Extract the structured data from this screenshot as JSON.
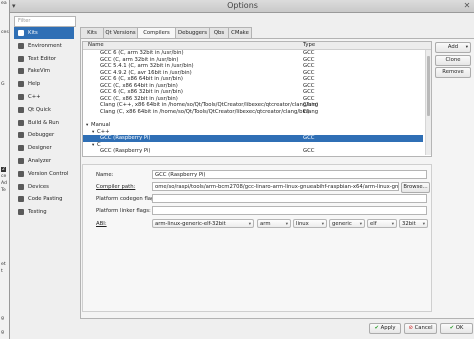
{
  "window": {
    "title": "Options"
  },
  "background_fragments": [
    {
      "text": "ea"
    },
    {
      "text": "ces"
    },
    {
      "text": "G"
    },
    {
      "text": "2"
    },
    {
      "text": "ce"
    },
    {
      "text": "Ad"
    },
    {
      "text": "Te"
    },
    {
      "text": "et"
    },
    {
      "text": "t"
    },
    {
      "text": "g"
    },
    {
      "text": "g"
    }
  ],
  "sidebar": {
    "filter_placeholder": "Filter",
    "items": [
      {
        "label": "Kits",
        "icon": "kits-icon",
        "color": "#3c7dd0",
        "selected": true
      },
      {
        "label": "Environment",
        "icon": "environment-icon",
        "color": "#5a5a5a"
      },
      {
        "label": "Text Editor",
        "icon": "text-editor-icon",
        "color": "#5a5a5a"
      },
      {
        "label": "FakeVim",
        "icon": "fakevim-icon",
        "color": "#5a5a5a"
      },
      {
        "label": "Help",
        "icon": "help-icon",
        "color": "#5a5a5a"
      },
      {
        "label": "C++",
        "icon": "cpp-icon",
        "color": "#5a5a5a"
      },
      {
        "label": "Qt Quick",
        "icon": "qt-quick-icon",
        "color": "#5a5a5a"
      },
      {
        "label": "Build & Run",
        "icon": "build-run-icon",
        "color": "#5a5a5a"
      },
      {
        "label": "Debugger",
        "icon": "debugger-icon",
        "color": "#5a5a5a"
      },
      {
        "label": "Designer",
        "icon": "designer-icon",
        "color": "#5a5a5a"
      },
      {
        "label": "Analyzer",
        "icon": "analyzer-icon",
        "color": "#5a5a5a"
      },
      {
        "label": "Version Control",
        "icon": "version-control-icon",
        "color": "#5a5a5a"
      },
      {
        "label": "Devices",
        "icon": "devices-icon",
        "color": "#5a5a5a"
      },
      {
        "label": "Code Pasting",
        "icon": "code-pasting-icon",
        "color": "#5a5a5a"
      },
      {
        "label": "Testing",
        "icon": "testing-icon",
        "color": "#5a5a5a"
      }
    ]
  },
  "tabs": [
    {
      "label": "Kits"
    },
    {
      "label": "Qt Versions"
    },
    {
      "label": "Compilers",
      "active": true
    },
    {
      "label": "Debuggers"
    },
    {
      "label": "Qbs"
    },
    {
      "label": "CMake"
    }
  ],
  "tree": {
    "columns": [
      "Name",
      "Type"
    ],
    "rows": [
      {
        "name": "GCC 6 (C, arm 32bit in /usr/bin)",
        "type": "GCC",
        "indent": 3
      },
      {
        "name": "GCC (C, arm 32bit in /usr/bin)",
        "type": "GCC",
        "indent": 3
      },
      {
        "name": "GCC 5.4.1 (C, arm 32bit in /usr/bin)",
        "type": "GCC",
        "indent": 3
      },
      {
        "name": "GCC 4.9.2 (C, avr 16bit in /usr/bin)",
        "type": "GCC",
        "indent": 3
      },
      {
        "name": "GCC 6 (C, x86 64bit in /usr/bin)",
        "type": "GCC",
        "indent": 3
      },
      {
        "name": "GCC (C, x86 64bit in /usr/bin)",
        "type": "GCC",
        "indent": 3
      },
      {
        "name": "GCC 6 (C, x86 32bit in /usr/bin)",
        "type": "GCC",
        "indent": 3
      },
      {
        "name": "GCC (C, x86 32bit in /usr/bin)",
        "type": "GCC",
        "indent": 3
      },
      {
        "name": "Clang (C++, x86 64bit in /home/so/Qt/Tools/QtCreator/libexec/qtcreator/clang/bin)",
        "type": "Clang",
        "indent": 3
      },
      {
        "name": "Clang (C, x86 64bit in /home/so/Qt/Tools/QtCreator/libexec/qtcreator/clang/bin)",
        "type": "Clang",
        "indent": 3
      },
      {
        "name": "",
        "type": "",
        "indent": 3
      },
      {
        "name": "Manual",
        "type": "",
        "indent": 1,
        "arrow": "▾"
      },
      {
        "name": "C++",
        "type": "",
        "indent": 2,
        "arrow": "▾"
      },
      {
        "name": "GCC (Raspberry Pi)",
        "type": "GCC",
        "indent": 3,
        "selected": true
      },
      {
        "name": "C",
        "type": "",
        "indent": 2,
        "arrow": "▾"
      },
      {
        "name": "GCC (Raspberry Pi)",
        "type": "GCC",
        "indent": 3
      }
    ]
  },
  "side_buttons": {
    "add": "Add",
    "add_arrow": "▾",
    "clone": "Clone",
    "remove": "Remove"
  },
  "details": {
    "name_label": "Name:",
    "name_value": "GCC (Raspberry Pi)",
    "path_label": "Compiler path:",
    "path_value": "ome/so/raspi/tools/arm-bcm2708/gcc-linaro-arm-linux-gnueabihf-raspbian-x64/arm-linux-gnueabihf/bin/gcc",
    "browse_label": "Browse...",
    "codegen_label": "Platform codegen flags:",
    "linker_label": "Platform linker flags:",
    "abi_label": "ABI:",
    "abi_values": [
      "arm-linux-generic-elf-32bit",
      "arm",
      "linux",
      "generic",
      "elf",
      "32bit"
    ]
  },
  "footer": {
    "apply": "Apply",
    "cancel": "Cancel",
    "ok": "OK"
  },
  "colors": {
    "selection": "#2f6fb5",
    "apply_icon": "#2a9d2a",
    "cancel_icon": "#cc2222",
    "ok_icon": "#2a9d2a"
  }
}
